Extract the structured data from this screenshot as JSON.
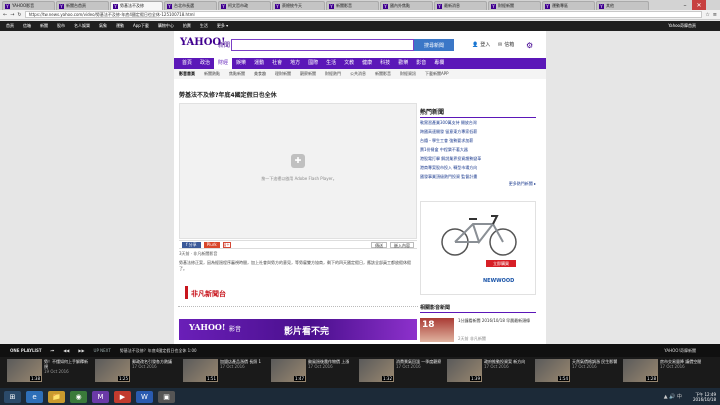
{
  "browser": {
    "tabs": [
      {
        "title": "YAHOO影音",
        "active": false
      },
      {
        "title": "新聞台首頁",
        "active": false
      },
      {
        "title": "勞基法不及修",
        "active": true
      },
      {
        "title": "台北市長選",
        "active": false
      },
      {
        "title": "柯文哲市政",
        "active": false
      },
      {
        "title": "蔡總統今天",
        "active": false
      },
      {
        "title": "新聞影音",
        "active": false
      },
      {
        "title": "國內外焦點",
        "active": false
      },
      {
        "title": "最新消息",
        "active": false
      },
      {
        "title": "財經新聞",
        "active": false
      },
      {
        "title": "運動專區",
        "active": false
      },
      {
        "title": "其他",
        "active": false
      }
    ],
    "url": "https://tw.news.yahoo.com/video/勞基法不及修-年底4國定假日也全休-125100718.html",
    "nav_back": "←",
    "nav_forward": "→",
    "reload": "↻",
    "star": "☆",
    "menu": "≡"
  },
  "yahoo_nav": {
    "items": [
      "首頁",
      "信箱",
      "新聞",
      "股市",
      "名人娛樂",
      "氣象",
      "運動",
      "App下載",
      "購物中心",
      "拍賣",
      "生活",
      "更多 ▾"
    ],
    "right": "Yahoo奇摩首頁"
  },
  "header": {
    "logo": "YAHOO!",
    "logo_cn": "奇摩",
    "section": "新聞",
    "search_button": "搜尋新聞",
    "login": "登入",
    "mail": "信箱"
  },
  "categories": [
    "首頁",
    "政治",
    "財經",
    "娛樂",
    "運動",
    "社會",
    "地方",
    "國際",
    "生活",
    "文教",
    "健康",
    "科技",
    "歡樂",
    "影音",
    "專欄"
  ],
  "active_category": "財經",
  "sub_nav": [
    "影音首頁",
    "新聞熱點",
    "焦點新聞",
    "美食趣",
    "理財新聞",
    "觀察新聞",
    "財經熱門",
    "公共消息",
    "新聞影音",
    "財經資訊",
    "下載新聞APP"
  ],
  "article": {
    "headline": "勞基法不及修?年底4國定假日也全休",
    "player_message": "按一下這裡以啟用 Adobe Flash Player。",
    "share_fb": "f 分享",
    "share_plurk": "Plurk",
    "share_gplus": "g+",
    "btn_email": "傳送",
    "btn_embed": "嵌入內容",
    "byline": "3天前 · 非凡新聞影音",
    "body": "勞基法修正案，因為經過程序審視時間，加上社會與勞方的意見，等勞雇雙方協商，剩下的四天國定假日，應該全部員工都放假休假了。",
    "partner_logo": "非凡新聞台",
    "banner_yahoo": "YAHOO!",
    "banner_section": "影音",
    "banner_slogan": "影片看不完"
  },
  "sidebar": {
    "hot_title": "熱門新聞",
    "hot_items": [
      "軟實習產業300萬支持 開放台灣",
      "跨國高速開發 留意東方專家低薪",
      "台鐵・學生工會 強勢要求加薪",
      "賣1份餐盒 中程樂不著大器",
      "港股電打擊 解說業界投資趨勢變革",
      "港商專案股市投入 轉型市場方向",
      "國發事業頂級熱門投資 監督計畫",
      "勞基法修案待審議 國定假日全休"
    ],
    "more": "更多熱門新聞 ▸",
    "ad_button": "立即購買",
    "ad_logo": "NEWWOOD",
    "video_title": "相關影音新聞",
    "video_item_title": "1分鐘看新聞 2016/10/18 早晨最新頭條",
    "video_item_meta": "2天前 非凡新聞",
    "video_item_num": "18"
  },
  "player_bar": {
    "label": "ONE PLAYLIST",
    "controls": [
      "⏮",
      "◀◀",
      "▶▶"
    ],
    "up_next": "UP NEXT",
    "next_title": "勞基法不及修？年底4國定假日也全休 1:00",
    "yahoo": "YAHOO!奇摩新聞",
    "thumbs": [
      {
        "title": "勞！不懂如何上手解釋新規",
        "date": "19 Oct 2016",
        "dur": "1:38"
      },
      {
        "title": "郵政改名引發各方熱議",
        "date": "17 Oct 2016",
        "dur": "1:25"
      },
      {
        "title": "加盟店產品漲價 長照 1",
        "date": "17 Oct 2016",
        "dur": "1:51"
      },
      {
        "title": "颱風過後農作物價 上漲",
        "date": "17 Oct 2016",
        "dur": "1:47"
      },
      {
        "title": "消費景氣回溫 一季度觀察",
        "date": "17 Oct 2016",
        "dur": "1:32"
      },
      {
        "title": "政府推動投資案 新方向",
        "date": "17 Oct 2016",
        "dur": "1:39"
      },
      {
        "title": "天然氣價格調漲 民生影響",
        "date": "17 Oct 2016",
        "dur": "1:54"
      },
      {
        "title": "房市交易量降 議價空間",
        "date": "17 Oct 2016",
        "dur": "1:28"
      }
    ]
  },
  "taskbar": {
    "apps": [
      "⊞",
      "e",
      "📁",
      "◉",
      "M",
      "▶",
      "W",
      "▣"
    ],
    "tray": "▲ 🔊 中",
    "time": "下午 12:49",
    "date": "2016/10/18"
  },
  "colors": {
    "yahoo_purple": "#400090",
    "category_bar": "#5b17b8",
    "link": "#1a3a8e"
  }
}
